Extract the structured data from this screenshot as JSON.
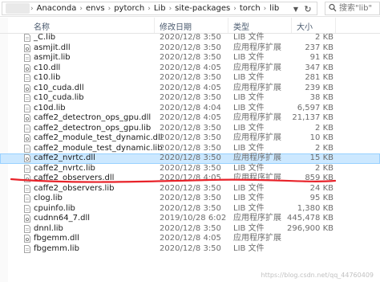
{
  "address": {
    "crumbs": [
      "Anaconda",
      "envs",
      "pytorch",
      "Lib",
      "site-packages",
      "torch",
      "lib"
    ],
    "search_placeholder": "搜索\"lib\""
  },
  "columns": {
    "name": "名称",
    "date": "修改日期",
    "type": "类型",
    "size": "大小"
  },
  "files": [
    {
      "name": "_C.lib",
      "date": "2020/12/8 3:50",
      "type": "LIB 文件",
      "size": "2 KB",
      "kind": "lib"
    },
    {
      "name": "asmjit.dll",
      "date": "2020/12/8 3:50",
      "type": "应用程序扩展",
      "size": "237 KB",
      "kind": "dll"
    },
    {
      "name": "asmjit.lib",
      "date": "2020/12/8 3:50",
      "type": "LIB 文件",
      "size": "91 KB",
      "kind": "lib"
    },
    {
      "name": "c10.dll",
      "date": "2020/12/8 4:05",
      "type": "应用程序扩展",
      "size": "347 KB",
      "kind": "dll"
    },
    {
      "name": "c10.lib",
      "date": "2020/12/8 3:50",
      "type": "LIB 文件",
      "size": "281 KB",
      "kind": "lib"
    },
    {
      "name": "c10_cuda.dll",
      "date": "2020/12/8 4:05",
      "type": "应用程序扩展",
      "size": "239 KB",
      "kind": "dll"
    },
    {
      "name": "c10_cuda.lib",
      "date": "2020/12/8 3:50",
      "type": "LIB 文件",
      "size": "38 KB",
      "kind": "lib"
    },
    {
      "name": "c10d.lib",
      "date": "2020/12/8 4:04",
      "type": "LIB 文件",
      "size": "6,597 KB",
      "kind": "lib"
    },
    {
      "name": "caffe2_detectron_ops_gpu.dll",
      "date": "2020/12/8 4:05",
      "type": "应用程序扩展",
      "size": "21,137 KB",
      "kind": "dll"
    },
    {
      "name": "caffe2_detectron_ops_gpu.lib",
      "date": "2020/12/8 3:50",
      "type": "LIB 文件",
      "size": "2 KB",
      "kind": "lib"
    },
    {
      "name": "caffe2_module_test_dynamic.dll",
      "date": "2020/12/8 3:50",
      "type": "应用程序扩展",
      "size": "10 KB",
      "kind": "dll"
    },
    {
      "name": "caffe2_module_test_dynamic.lib",
      "date": "2020/12/8 3:50",
      "type": "LIB 文件",
      "size": "2 KB",
      "kind": "lib"
    },
    {
      "name": "caffe2_nvrtc.dll",
      "date": "2020/12/8 3:50",
      "type": "应用程序扩展",
      "size": "15 KB",
      "kind": "dll",
      "selected": true
    },
    {
      "name": "caffe2_nvrtc.lib",
      "date": "2020/12/8 3:50",
      "type": "LIB 文件",
      "size": "2 KB",
      "kind": "lib"
    },
    {
      "name": "caffe2_observers.dll",
      "date": "2020/12/8 4:05",
      "type": "应用程序扩展",
      "size": "859 KB",
      "kind": "dll"
    },
    {
      "name": "caffe2_observers.lib",
      "date": "2020/12/8 3:50",
      "type": "LIB 文件",
      "size": "24 KB",
      "kind": "lib"
    },
    {
      "name": "clog.lib",
      "date": "2020/12/8 3:50",
      "type": "LIB 文件",
      "size": "95 KB",
      "kind": "lib"
    },
    {
      "name": "cpuinfo.lib",
      "date": "2020/12/8 3:50",
      "type": "LIB 文件",
      "size": "1,380 KB",
      "kind": "lib"
    },
    {
      "name": "cudnn64_7.dll",
      "date": "2019/10/28 6:02",
      "type": "应用程序扩展",
      "size": "445,478 KB",
      "kind": "dll"
    },
    {
      "name": "dnnl.lib",
      "date": "2020/12/8 3:50",
      "type": "LIB 文件",
      "size": "296,900 KB",
      "kind": "lib"
    },
    {
      "name": "fbgemm.dll",
      "date": "2020/12/8 4:05",
      "type": "应用程序扩展",
      "size": "",
      "kind": "dll"
    },
    {
      "name": "fbgemm.lib",
      "date": "2020/12/8 3:50",
      "type": "LIB 文件",
      "size": "",
      "kind": "lib"
    }
  ],
  "icons": {
    "dll": "dll-file-icon",
    "lib": "lib-file-icon"
  },
  "colors": {
    "selection": "#cce8ff",
    "selection_border": "#99d1ff",
    "annotation": "#e8232a"
  },
  "watermark": "https://blog.csdn.net/qq_44760409"
}
